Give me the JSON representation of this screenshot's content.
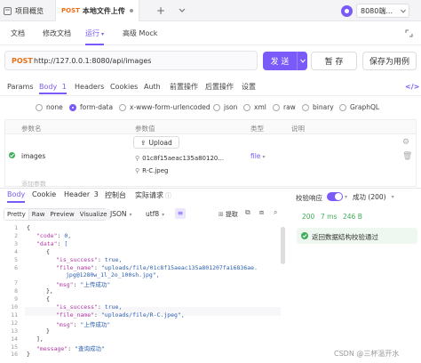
{
  "tabs": {
    "project_overview": "项目概览",
    "active_method": "POST",
    "active_title": "本地文件上传",
    "add": "+",
    "env": "8080端..."
  },
  "subtabs": [
    "文档",
    "修改文档",
    "运行",
    "高级 Mock"
  ],
  "request": {
    "method": "POST",
    "url": "http://127.0.0.1:8080/api/images",
    "send": "发 送",
    "save": "暂 存",
    "save_as": "保存为用例"
  },
  "req_tabs": [
    {
      "label": "Params"
    },
    {
      "label": "Body",
      "count": "1"
    },
    {
      "label": "Headers"
    },
    {
      "label": "Cookies"
    },
    {
      "label": "Auth"
    },
    {
      "label": "前置操作"
    },
    {
      "label": "后置操作"
    },
    {
      "label": "设置"
    }
  ],
  "body_types": [
    "none",
    "form-data",
    "x-www-form-urlencoded",
    "json",
    "xml",
    "raw",
    "binary",
    "GraphQL"
  ],
  "params_table": {
    "headers": [
      "参数名",
      "参数值",
      "类型",
      "说明"
    ],
    "row": {
      "name": "images",
      "upload": "Upload",
      "file1": "01c8f15aeac135a80120...",
      "file2": "R-C.jpeg",
      "type": "file"
    },
    "add_param": "添加参数"
  },
  "resp_tabs": [
    {
      "label": "Body"
    },
    {
      "label": "Cookie"
    },
    {
      "label": "Header",
      "count": "3"
    },
    {
      "label": "控制台"
    },
    {
      "label": "实际请求"
    }
  ],
  "format_bar": {
    "pretty": "Pretty",
    "raw": "Raw",
    "preview": "Preview",
    "visualize": "Visualize",
    "format": "JSON",
    "encoding": "utf8",
    "extract": "提取"
  },
  "validation": {
    "label": "校验响应",
    "result": "成功 (200)",
    "status": "200",
    "time": "7 ms",
    "size": "246 B",
    "message": "返回数据结构校验通过"
  },
  "code_lines": [
    {
      "n": "1",
      "text": "{"
    },
    {
      "n": "2",
      "text": "\"code\": 0,"
    },
    {
      "n": "3",
      "text": "\"data\": ["
    },
    {
      "n": "4",
      "text": "{"
    },
    {
      "n": "5",
      "text": "\"is_success\": true,"
    },
    {
      "n": "6",
      "text": "\"file_name\": \"uploads/file/01c8f15aeac135a801207fa16836ae."
    },
    {
      "n": "",
      "text": "jpg@1280w_1l_2o_100sh.jpg\","
    },
    {
      "n": "7",
      "text": "\"msg\": \"上传成功\""
    },
    {
      "n": "8",
      "text": "},"
    },
    {
      "n": "9",
      "text": "{"
    },
    {
      "n": "10",
      "text": "\"is_success\": true,"
    },
    {
      "n": "11",
      "text": "\"file_name\": \"uploads/file/R-C.jpeg\","
    },
    {
      "n": "12",
      "text": "\"msg\": \"上传成功\""
    },
    {
      "n": "13",
      "text": "}"
    },
    {
      "n": "14",
      "text": "],"
    },
    {
      "n": "15",
      "text": "\"message\": \"查询成功\""
    },
    {
      "n": "16",
      "text": "}"
    }
  ],
  "watermark": "CSDN @三杯温开水",
  "colors": {
    "accent": "#7a5af8",
    "post": "#e8701a",
    "success": "#3fae5b"
  }
}
